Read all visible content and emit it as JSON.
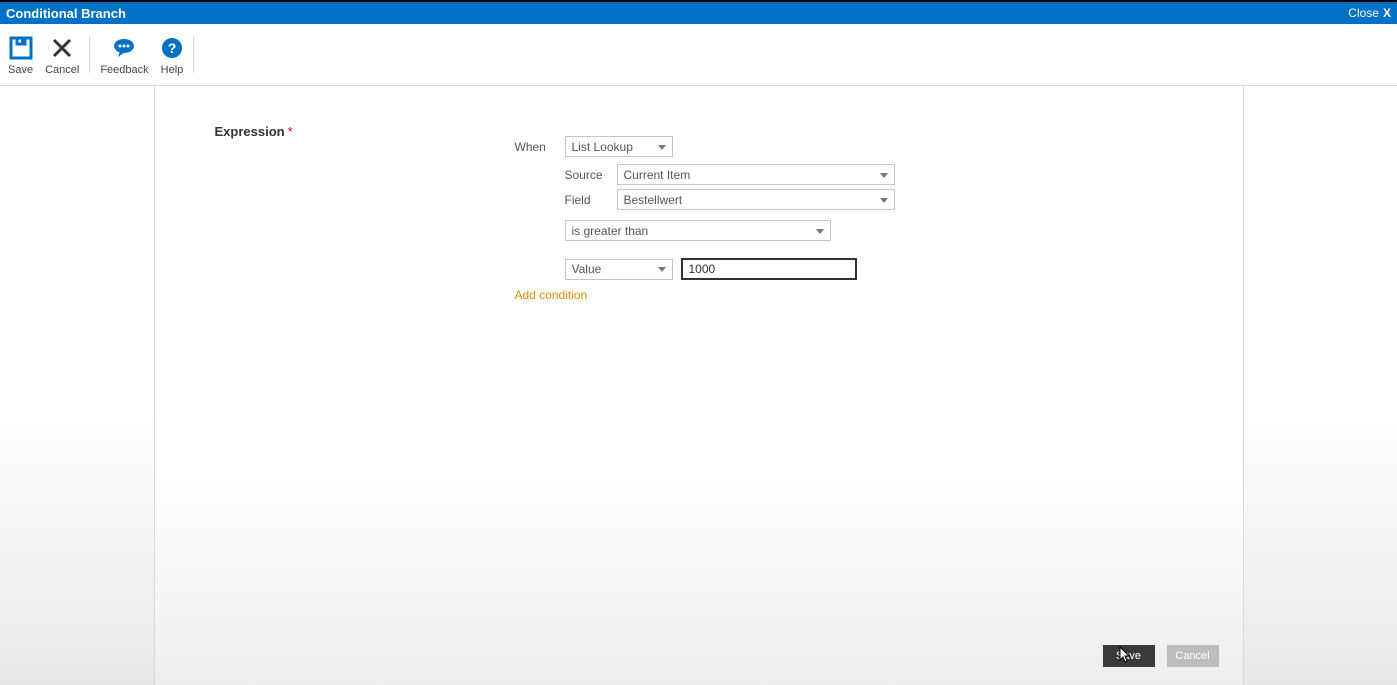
{
  "titlebar": {
    "title": "Conditional Branch",
    "close": "Close"
  },
  "ribbon": {
    "save": "Save",
    "cancel": "Cancel",
    "feedback": "Feedback",
    "help": "Help"
  },
  "form": {
    "expression_label": "Expression",
    "when_label": "When",
    "when_value": "List Lookup",
    "source_label": "Source",
    "source_value": "Current Item",
    "field_label": "Field",
    "field_value": "Bestellwert",
    "operator_value": "is greater than",
    "comparator_value": "Value",
    "value_input": "1000",
    "add_condition": "Add condition"
  },
  "footer": {
    "save": "Save",
    "cancel": "Cancel"
  }
}
